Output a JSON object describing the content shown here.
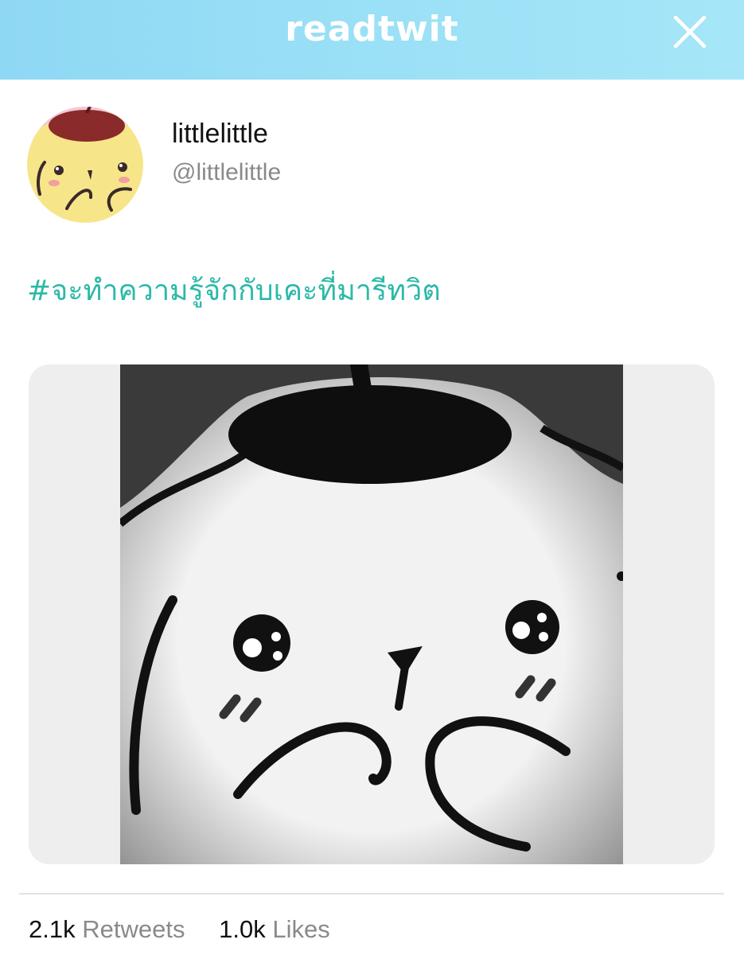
{
  "header": {
    "brand": "readtwit",
    "close_icon": "close-icon",
    "background_color": "#9be0f6"
  },
  "tweet": {
    "display_name": "littlelittle",
    "handle": "@littlelittle",
    "avatar_icon": "avatar-image",
    "hashtag": "#จะทำความรู้จักกับเคะที่มารีทวิต",
    "hashtag_color": "#2cb9a8",
    "media_icon": "media-image"
  },
  "stats": {
    "retweets_count": "2.1k",
    "retweets_label": "Retweets",
    "likes_count": "1.0k",
    "likes_label": "Likes"
  }
}
